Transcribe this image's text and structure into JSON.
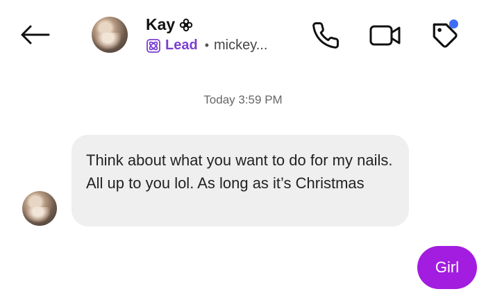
{
  "header": {
    "back_icon": "arrow-left-icon",
    "contact_name": "Kay",
    "name_badge_icon": "flower-icon",
    "lead_icon": "lead-atom-icon",
    "lead_label": "Lead",
    "dot_separator": "•",
    "username": "mickey...",
    "actions": [
      {
        "icon": "phone-icon"
      },
      {
        "icon": "video-camera-icon"
      },
      {
        "icon": "tag-icon",
        "has_notification_dot": true
      }
    ]
  },
  "conversation": {
    "timestamp": "Today 3:59 PM",
    "messages": [
      {
        "direction": "incoming",
        "text": "Think about what you want to do for my nails. All up to you lol. As long as it’s Christmas"
      },
      {
        "direction": "outgoing",
        "text": "Girl"
      }
    ]
  },
  "colors": {
    "lead_purple": "#7b3fd0",
    "outgoing_bubble": "#a21ddf",
    "incoming_bubble": "#efefef",
    "notification_dot": "#3f6df2"
  }
}
